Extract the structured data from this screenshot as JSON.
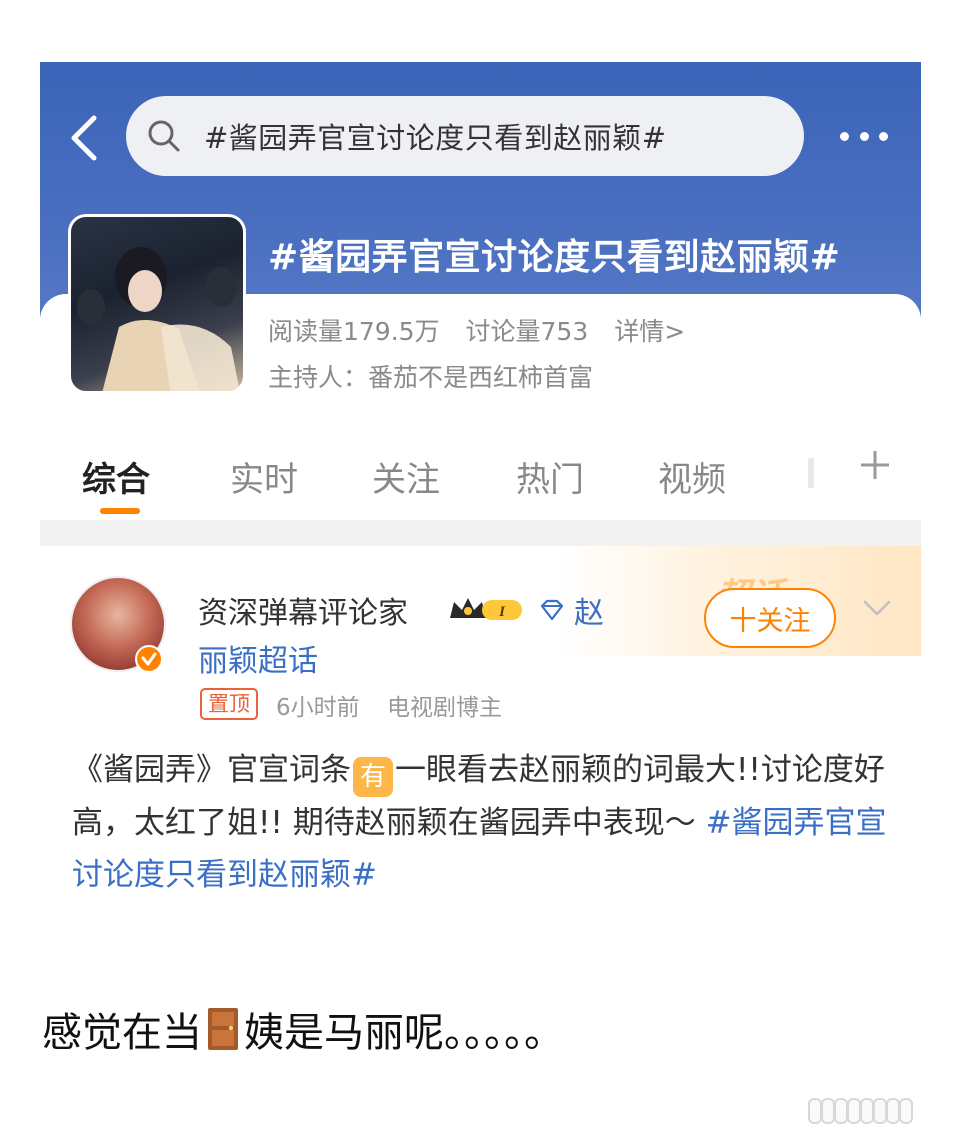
{
  "search": {
    "query": "#酱园弄官宣讨论度只看到赵丽颖#"
  },
  "topic": {
    "title": "#酱园弄官宣讨论度只看到赵丽颖#",
    "reads": "阅读量179.5万",
    "discussions": "讨论量753",
    "details": "详情>",
    "host": "主持人：番茄不是西红柿首富"
  },
  "tabs": [
    {
      "label": "综合"
    },
    {
      "label": "实时"
    },
    {
      "label": "关注"
    },
    {
      "label": "热门"
    },
    {
      "label": "视频"
    }
  ],
  "post": {
    "username": "资深弹幕评论家",
    "level_badge": "I",
    "supertopic_part1": "赵",
    "supertopic_part2": "丽颖超话",
    "follow_label": "十关注",
    "banner_text": "超话",
    "pin_label": "置顶",
    "time": "6小时前",
    "source": "电视剧博主",
    "text_before": "《酱园弄》官宣词条",
    "you_label": "有",
    "text_after": "一眼看去赵丽颖的词最大!!讨论度好高，太红了姐!! 期待赵丽颖在酱园弄中表现～ ",
    "hashtag": "#酱园弄官宣讨论度只看到赵丽颖#"
  },
  "caption": {
    "before": "感觉在当",
    "after": "姨是马丽呢。。。。。"
  },
  "colors": {
    "brand_orange": "#ff8200",
    "link_blue": "#3b6fc6",
    "header_blue": "#3a64b8"
  }
}
